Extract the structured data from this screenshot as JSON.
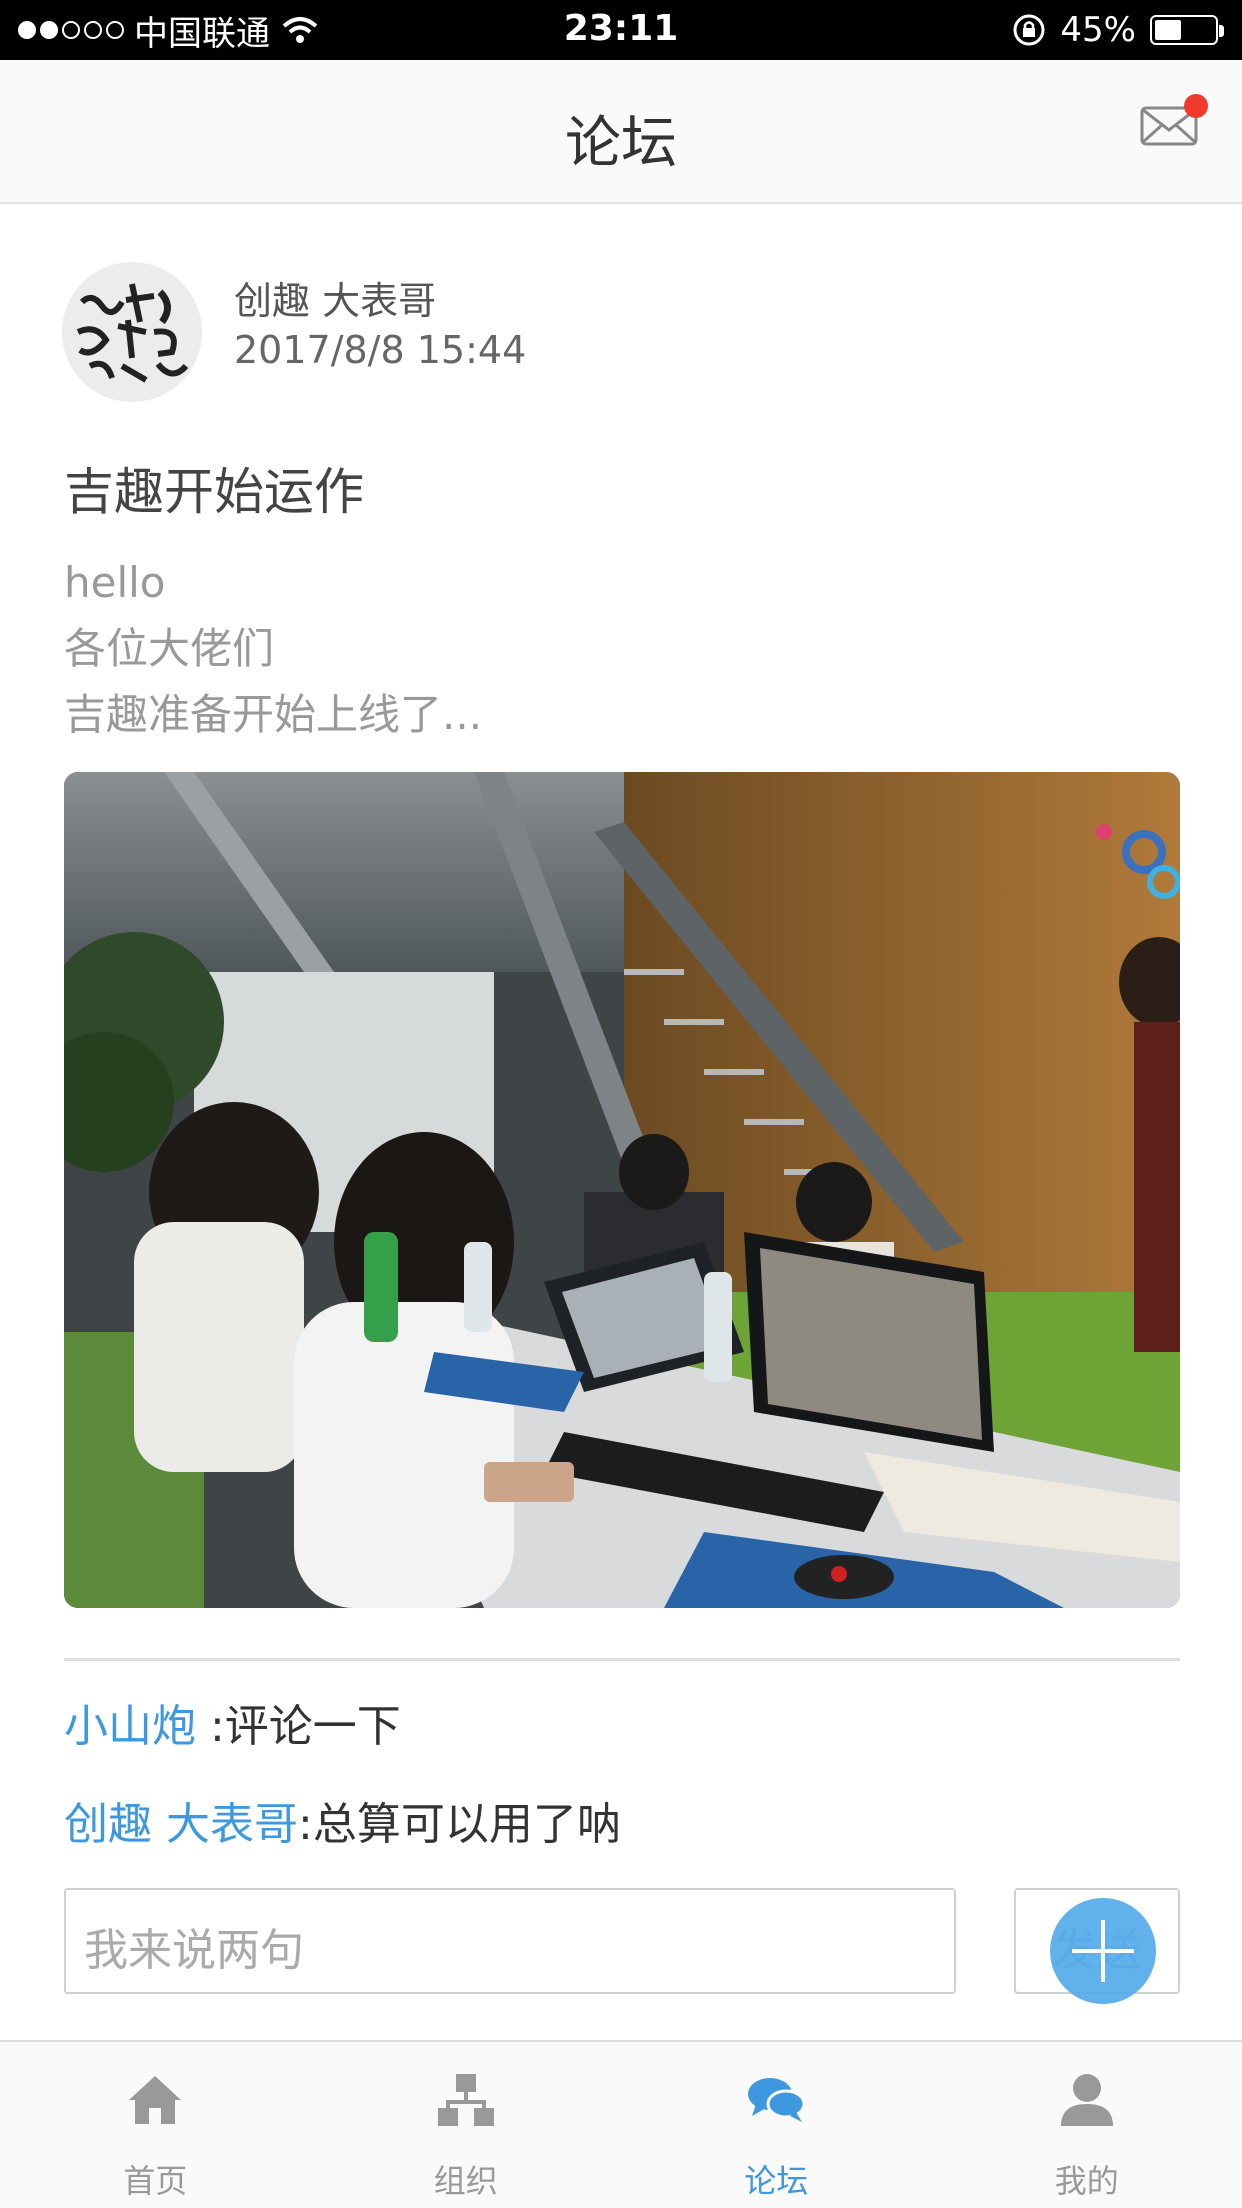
{
  "status_bar": {
    "carrier": "中国联通",
    "time": "23:11",
    "battery": "45%",
    "battery_level": 0.45
  },
  "nav": {
    "title": "论坛",
    "mail_icon": "mail-icon",
    "has_unread": true
  },
  "post": {
    "author": "创趣 大表哥",
    "time": "2017/8/8 15:44",
    "title": "吉趣开始运作",
    "body_lines": [
      "hello",
      "各位大佬们",
      "吉趣准备开始上线了..."
    ],
    "avatar_icon": "calligraphy-avatar"
  },
  "comments": [
    {
      "name": "小山炮",
      "text": " :评论一下"
    },
    {
      "name": "创趣 大表哥",
      "text": ":总算可以用了呐"
    }
  ],
  "comment_input": {
    "placeholder": "我来说两句",
    "send_label": "发送"
  },
  "tabs": [
    {
      "label": "首页",
      "icon": "home-icon",
      "active": false
    },
    {
      "label": "组织",
      "icon": "org-icon",
      "active": false
    },
    {
      "label": "论坛",
      "icon": "chat-bubbles-icon",
      "active": true
    },
    {
      "label": "我的",
      "icon": "person-icon",
      "active": false
    }
  ],
  "colors": {
    "accent": "#3d98e0",
    "badge": "#f03a2c",
    "fab": "#54aaec"
  }
}
